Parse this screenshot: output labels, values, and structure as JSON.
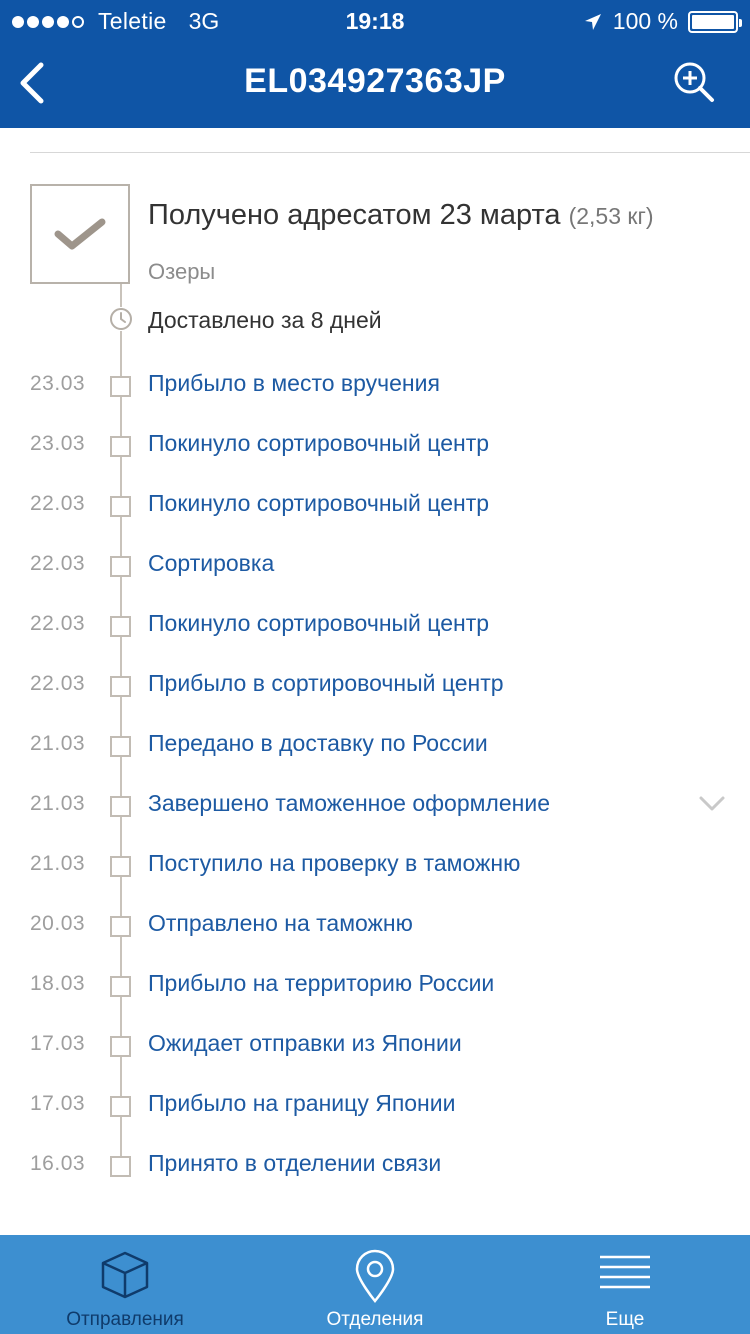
{
  "status_bar": {
    "carrier": "Teletie",
    "network": "3G",
    "time": "19:18",
    "battery": "100 %"
  },
  "header": {
    "title": "EL034927363JP"
  },
  "summary": {
    "status": "Получено адресатом 23 марта",
    "weight": "(2,53 кг)",
    "city": "Озеры",
    "delivered_in": "Доставлено за 8 дней"
  },
  "events": [
    {
      "date": "23.03",
      "label": "Прибыло в место вручения"
    },
    {
      "date": "23.03",
      "label": "Покинуло сортировочный центр"
    },
    {
      "date": "22.03",
      "label": "Покинуло сортировочный центр"
    },
    {
      "date": "22.03",
      "label": "Сортировка"
    },
    {
      "date": "22.03",
      "label": "Покинуло сортировочный центр"
    },
    {
      "date": "22.03",
      "label": "Прибыло в сортировочный центр"
    },
    {
      "date": "21.03",
      "label": "Передано в доставку по России"
    },
    {
      "date": "21.03",
      "label": "Завершено таможенное оформление"
    },
    {
      "date": "21.03",
      "label": "Поступило на проверку в таможню"
    },
    {
      "date": "20.03",
      "label": "Отправлено на таможню"
    },
    {
      "date": "18.03",
      "label": "Прибыло на территорию России"
    },
    {
      "date": "17.03",
      "label": "Ожидает отправки из Японии"
    },
    {
      "date": "17.03",
      "label": "Прибыло на границу Японии"
    },
    {
      "date": "16.03",
      "label": "Принято в отделении связи"
    }
  ],
  "tabbar": {
    "tabs": [
      {
        "label": "Отправления",
        "icon": "box-icon",
        "active": true
      },
      {
        "label": "Отделения",
        "icon": "location-pin-icon",
        "active": false
      },
      {
        "label": "Еще",
        "icon": "menu-icon",
        "active": false
      }
    ]
  },
  "colors": {
    "header": "#0f55a6",
    "tabbar": "#3d8fd0",
    "link": "#1d5aa3"
  }
}
